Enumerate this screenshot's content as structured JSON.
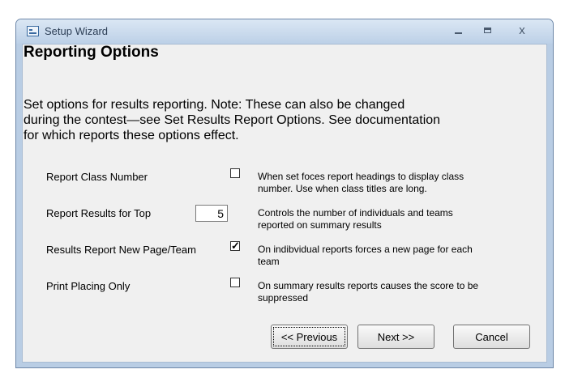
{
  "window": {
    "title": "Setup Wizard",
    "controls": {
      "minimize": "minimize",
      "maximize": "maximize",
      "close": "x"
    }
  },
  "heading": "Reporting Options",
  "intro": "Set options for results reporting.  Note:  These can also be changed\nduring the contest—see Set Results Report Options.  See documentation\nfor which reports these options effect.",
  "options": [
    {
      "label": "Report Class Number",
      "checked": false,
      "description": "When set foces report headings to display class\nnumber.  Use when class titles are long."
    },
    {
      "label": "Report Results for Top",
      "value": "5",
      "description": "Controls the number of individuals and teams\nreported on summary results"
    },
    {
      "label": "Results Report New Page/Team",
      "checked": true,
      "description": "On indibvidual reports forces a new page for each\nteam"
    },
    {
      "label": "Print Placing Only",
      "checked": false,
      "description": "On summary results reports causes the score to be\nsuppressed"
    }
  ],
  "buttons": {
    "previous": "<< Previous",
    "next": "Next >>",
    "cancel": "Cancel"
  }
}
